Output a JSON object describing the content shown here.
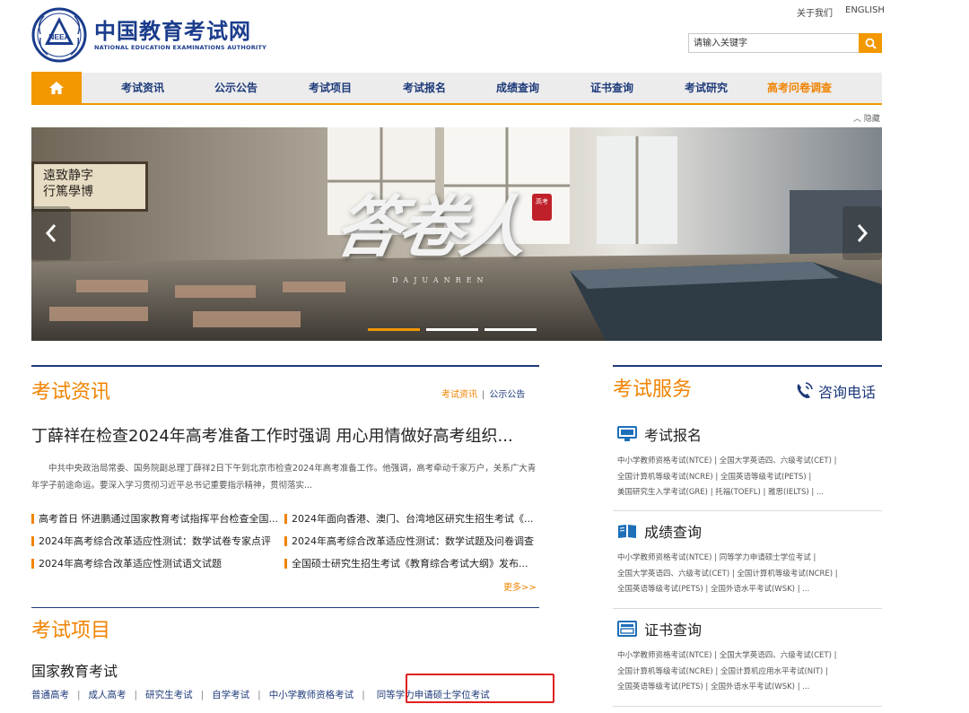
{
  "top_links": {
    "about": "关于我们",
    "english": "ENGLISH"
  },
  "logo": {
    "emblem_text": "NEEA",
    "cn": "中国教育考试网",
    "en": "NATIONAL EDUCATION EXAMINATIONS AUTHORITY"
  },
  "search": {
    "placeholder": "请输入关键字",
    "icon": "search-icon"
  },
  "nav": {
    "home_icon": "home-icon",
    "items": [
      "考试资讯",
      "公示公告",
      "考试项目",
      "考试报名",
      "成绩查询",
      "证书查询",
      "考试研究",
      "高考问卷调查"
    ],
    "highlight_color": "#f08300"
  },
  "hide_label": "隐藏",
  "banner": {
    "title": "答卷人",
    "pinyin": "DAJUANREN",
    "seal": "高考",
    "calligraphy_line1": "遠致静字",
    "calligraphy_line2": "行篤學博",
    "active_slide": 1,
    "slide_count": 3
  },
  "news": {
    "title": "考试资讯",
    "tab_active": "考试资讯",
    "tab_other": "公示公告",
    "headline": "丁薛祥在检查2024年高考准备工作时强调 用心用情做好高考组织...",
    "summary": "中共中央政治局常委、国务院副总理丁薛祥2日下午到北京市检查2024年高考准备工作。他强调，高考牵动千家万户，关系广大青年学子前途命运。要深入学习贯彻习近平总书记重要指示精神，贯彻落实...",
    "items": [
      "高考首日 怀进鹏通过国家教育考试指挥平台检查全国...",
      "2024年面向香港、澳门、台湾地区研究生招生考试《...",
      "2024年高考综合改革适应性测试：数学试卷专家点评",
      "2024年高考综合改革适应性测试：数学试题及问卷调查",
      "2024年高考综合改革适应性测试语文试题",
      "全国硕士研究生招生考试《教育综合考试大纲》发布..."
    ],
    "more": "更多>>"
  },
  "projects": {
    "title": "考试项目",
    "subtitle": "国家教育考试",
    "links": [
      "普通高考",
      "成人高考",
      "研究生考试",
      "自学考试",
      "中小学教师资格考试",
      "同等学力申请硕士学位考试"
    ],
    "highlighted": "同等学力申请硕士学位考试"
  },
  "services": {
    "title": "考试服务",
    "phone_label": "咨询电话",
    "blocks": [
      {
        "title": "考试报名",
        "icon": "monitor-icon",
        "lines": [
          "中小学教师资格考试(NTCE) | 全国大学英语四、六级考试(CET) |",
          "全国计算机等级考试(NCRE) | 全国英语等级考试(PETS) |",
          "美国研究生入学考试(GRE) | 托福(TOEFL) | 雅思(IELTS) | ..."
        ]
      },
      {
        "title": "成绩查询",
        "icon": "book-icon",
        "lines": [
          "中小学教师资格考试(NTCE) | 同等学力申请硕士学位考试 |",
          "全国大学英语四、六级考试(CET) | 全国计算机等级考试(NCRE) |",
          "全国英语等级考试(PETS) | 全国外语水平考试(WSK) | ..."
        ]
      },
      {
        "title": "证书查询",
        "icon": "certificate-icon",
        "lines": [
          "中小学教师资格考试(NTCE) | 全国大学英语四、六级考试(CET) |",
          "全国计算机等级考试(NCRE) | 全国计算机应用水平考试(NIT) |",
          "全国英语等级考试(PETS) | 全国外语水平考试(WSK) | ..."
        ]
      }
    ]
  },
  "colors": {
    "accent": "#f39800",
    "navy": "#1d3a7a",
    "highlight_box": "#e02020"
  }
}
